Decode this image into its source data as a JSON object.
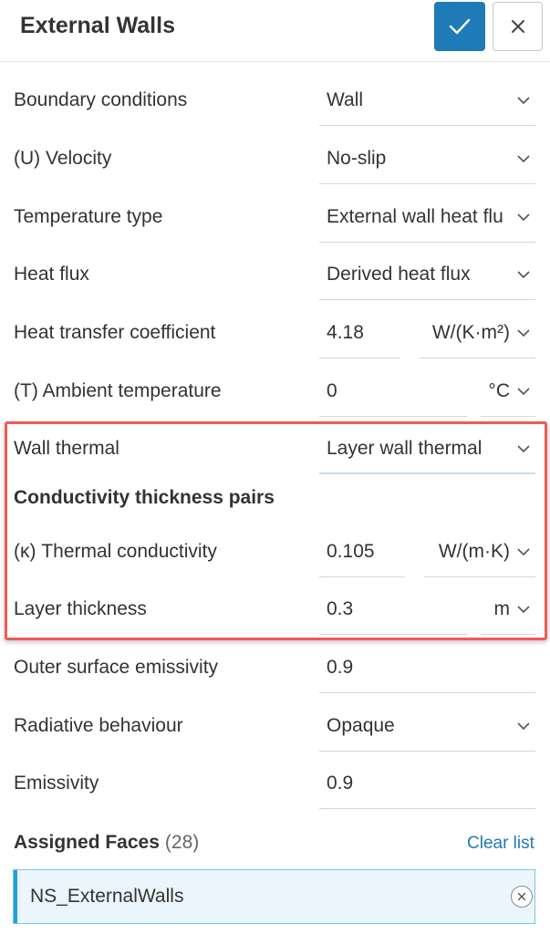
{
  "header": {
    "title": "External Walls",
    "confirm_icon": "check-icon",
    "close_icon": "close-icon",
    "accent_color": "#1f7ab8"
  },
  "rows": {
    "boundary_conditions": {
      "label": "Boundary conditions",
      "value": "Wall"
    },
    "velocity": {
      "label": "(U) Velocity",
      "value": "No-slip"
    },
    "temperature_type": {
      "label": "Temperature type",
      "value": "External wall heat flu"
    },
    "heat_flux": {
      "label": "Heat flux",
      "value": "Derived heat flux"
    },
    "heat_transfer_coefficient": {
      "label": "Heat transfer coefficient",
      "value": "4.18",
      "unit": "W/(K·m²)"
    },
    "ambient_temperature": {
      "label": "(T) Ambient temperature",
      "value": "0",
      "unit": "°C"
    },
    "wall_thermal": {
      "label": "Wall thermal",
      "value": "Layer wall thermal"
    },
    "conductivity_pairs": {
      "label": "Conductivity thickness pairs"
    },
    "thermal_conductivity": {
      "label": "(κ) Thermal conductivity",
      "value": "0.105",
      "unit": "W/(m·K)"
    },
    "layer_thickness": {
      "label": "Layer thickness",
      "value": "0.3",
      "unit": "m"
    },
    "outer_surface_emissivity": {
      "label": "Outer surface emissivity",
      "value": "0.9"
    },
    "radiative_behaviour": {
      "label": "Radiative behaviour",
      "value": "Opaque"
    },
    "emissivity": {
      "label": "Emissivity",
      "value": "0.9"
    }
  },
  "assigned": {
    "title": "Assigned Faces",
    "count": "(28)",
    "clear_label": "Clear list",
    "items": [
      "NS_ExternalWalls"
    ]
  },
  "highlight_color": "#ee5b57"
}
